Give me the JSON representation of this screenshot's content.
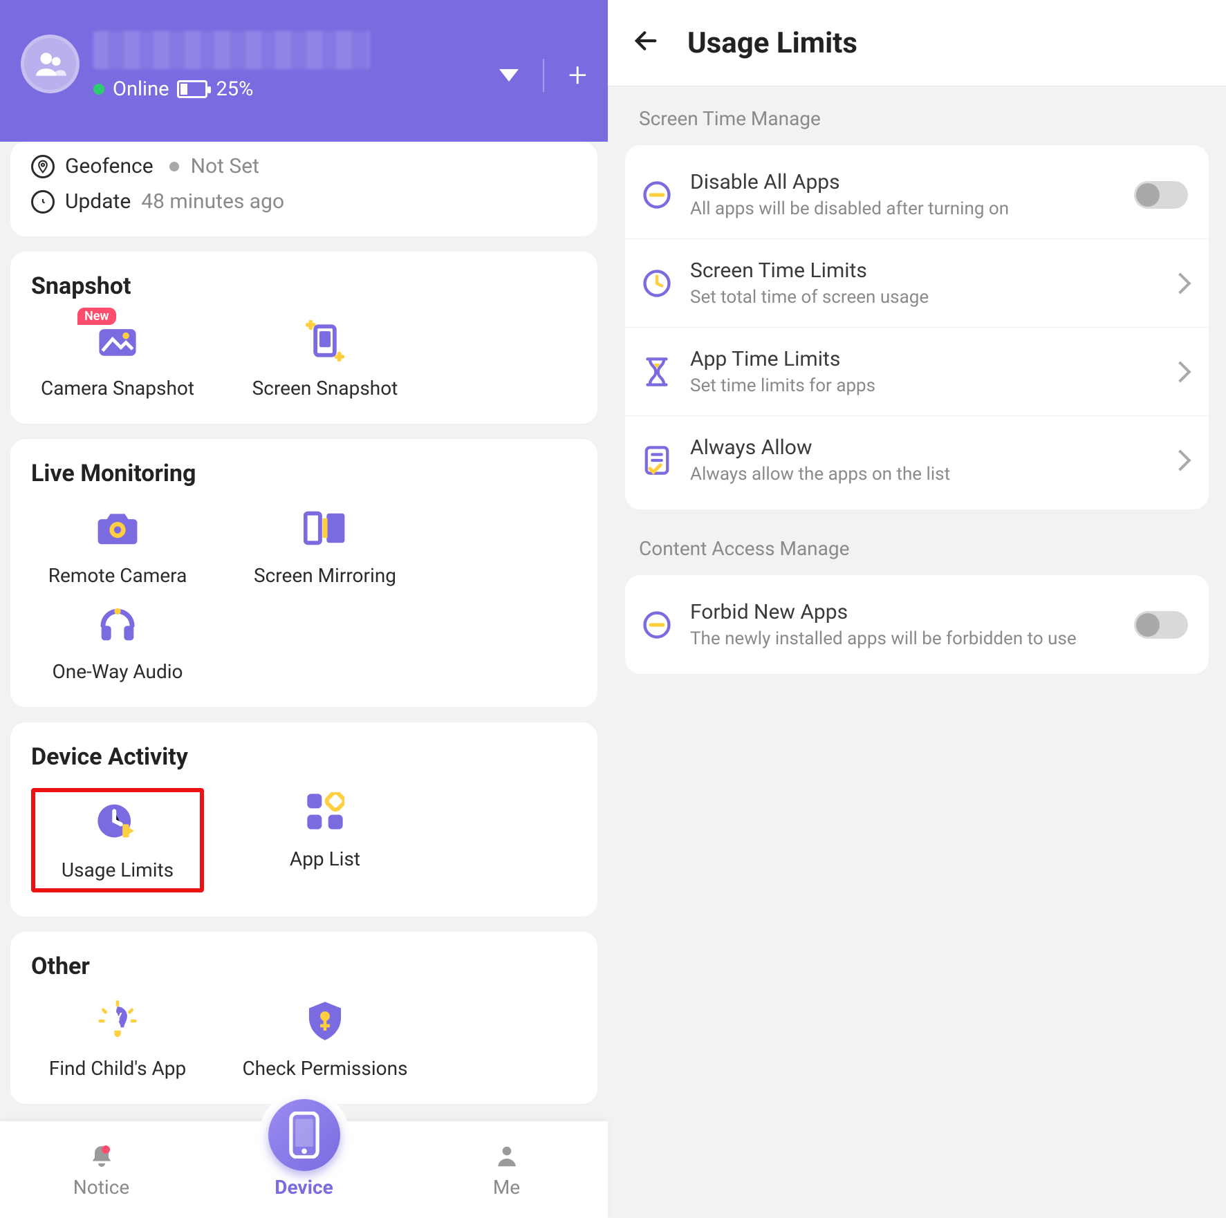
{
  "left": {
    "status": {
      "online": "Online",
      "battery": "25%"
    },
    "topInfo": {
      "geofence_label": "Geofence",
      "geofence_value": "Not Set",
      "update_label": "Update",
      "update_value": "48 minutes ago"
    },
    "sections": {
      "snapshot": {
        "title": "Snapshot",
        "items": [
          {
            "label": "Camera Snapshot",
            "icon": "camera-snapshot-icon",
            "badge": "New"
          },
          {
            "label": "Screen Snapshot",
            "icon": "screen-snapshot-icon"
          }
        ]
      },
      "live": {
        "title": "Live Monitoring",
        "items": [
          {
            "label": "Remote Camera",
            "icon": "remote-camera-icon"
          },
          {
            "label": "Screen Mirroring",
            "icon": "screen-mirroring-icon"
          },
          {
            "label": "One-Way Audio",
            "icon": "one-way-audio-icon"
          }
        ]
      },
      "activity": {
        "title": "Device Activity",
        "items": [
          {
            "label": "Usage Limits",
            "icon": "usage-limits-icon",
            "highlighted": true
          },
          {
            "label": "App List",
            "icon": "app-list-icon"
          }
        ]
      },
      "other": {
        "title": "Other",
        "items": [
          {
            "label": "Find Child's App",
            "icon": "find-child-app-icon"
          },
          {
            "label": "Check Permissions",
            "icon": "check-permissions-icon"
          }
        ]
      }
    },
    "nav": {
      "notice": "Notice",
      "device": "Device",
      "me": "Me"
    }
  },
  "right": {
    "title": "Usage Limits",
    "section1": "Screen Time Manage",
    "items1": [
      {
        "title": "Disable All Apps",
        "sub": "All apps will be disabled after turning on",
        "trailing": "toggle"
      },
      {
        "title": "Screen Time Limits",
        "sub": "Set total time of screen usage",
        "trailing": "chevron"
      },
      {
        "title": "App Time Limits",
        "sub": "Set time limits for apps",
        "trailing": "chevron"
      },
      {
        "title": "Always Allow",
        "sub": "Always allow the apps on the list",
        "trailing": "chevron"
      }
    ],
    "section2": "Content Access Manage",
    "items2": [
      {
        "title": "Forbid New Apps",
        "sub": "The newly installed apps will be forbidden to use",
        "trailing": "toggle"
      }
    ]
  }
}
